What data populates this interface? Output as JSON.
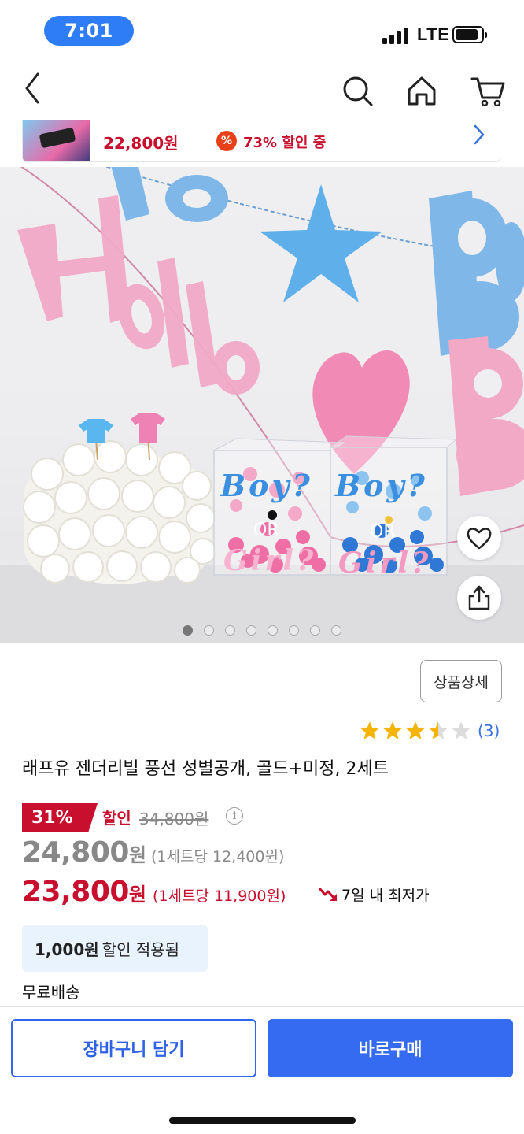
{
  "status_bar": {
    "time": "7:01",
    "network": "LTE"
  },
  "nav": {
    "icons": [
      "back-icon",
      "search-icon",
      "home-icon",
      "cart-icon"
    ]
  },
  "mini_banner": {
    "price": "22,800원",
    "badge": "%",
    "discount_text": "73% 할인 중"
  },
  "product_image": {
    "page_count": 8,
    "current_page": 1,
    "box_text_top": "Boy?",
    "box_text_mid": "OR",
    "box_text_bottom": "Girl?",
    "banner_text": "Hello",
    "icons": [
      "heart-icon",
      "share-icon"
    ]
  },
  "product": {
    "detail_button": "상품상세",
    "rating": 3.5,
    "review_count": "(3)",
    "title": "래프유 젠더리빌 풍선 성별공개, 골드+미정, 2세트"
  },
  "pricing": {
    "discount_rate": "31%",
    "discount_label": "할인",
    "original_price": "34,800원",
    "info_icon": "i",
    "sale_price_number": "24,800",
    "sale_price_won": "원",
    "sale_unit_price": "(1세트당 12,400원)",
    "final_price_number": "23,800",
    "final_price_won": "원",
    "final_unit_price": "(1세트당 11,900원)",
    "lowest_price_label": "7일 내 최저가"
  },
  "coupon": {
    "amount": "1,000원",
    "text": "할인 적용됨"
  },
  "shipping": {
    "text": "무료배송"
  },
  "actions": {
    "cart_button": "장바구니 담기",
    "buy_button": "바로구매"
  },
  "colors": {
    "accent_blue": "#346bf0",
    "price_red": "#c8102e",
    "star_yellow": "#f5b400"
  }
}
